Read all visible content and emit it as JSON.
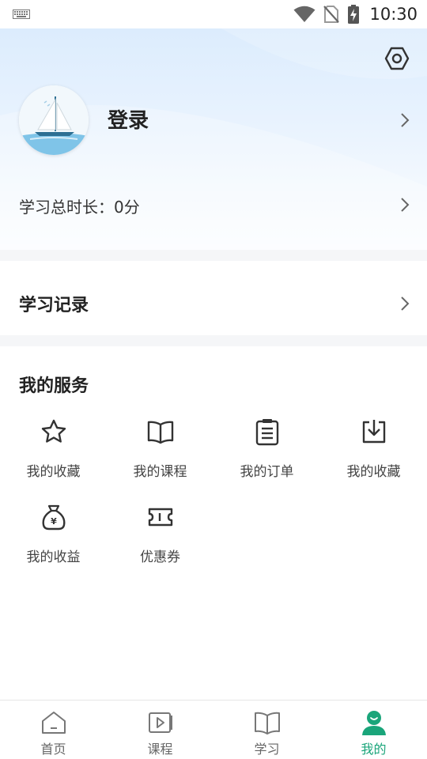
{
  "status_bar": {
    "time": "10:30",
    "icons": [
      "keyboard-icon",
      "wifi-icon",
      "no-sim-icon",
      "battery-charging-icon"
    ]
  },
  "profile": {
    "settings_icon": "settings-hexagon-icon",
    "avatar_icon": "sailboat-avatar",
    "login_label": "登录",
    "duration_label": "学习总时长：0分"
  },
  "study_record": {
    "label": "学习记录"
  },
  "services": {
    "title": "我的服务",
    "items": [
      {
        "label": "我的收藏",
        "icon": "star-icon"
      },
      {
        "label": "我的课程",
        "icon": "book-icon"
      },
      {
        "label": "我的订单",
        "icon": "clipboard-icon"
      },
      {
        "label": "我的收藏",
        "icon": "download-tray-icon"
      },
      {
        "label": "我的收益",
        "icon": "money-bag-icon"
      },
      {
        "label": "优惠券",
        "icon": "ticket-icon"
      }
    ]
  },
  "tabbar": {
    "tabs": [
      {
        "label": "首页",
        "icon": "home-icon",
        "active": false
      },
      {
        "label": "课程",
        "icon": "video-course-icon",
        "active": false
      },
      {
        "label": "学习",
        "icon": "open-book-icon",
        "active": false
      },
      {
        "label": "我的",
        "icon": "user-icon",
        "active": true
      }
    ]
  },
  "colors": {
    "accent": "#1aa57a",
    "header_gradient_top": "#dcecfd",
    "divider": "#f5f6f8"
  }
}
